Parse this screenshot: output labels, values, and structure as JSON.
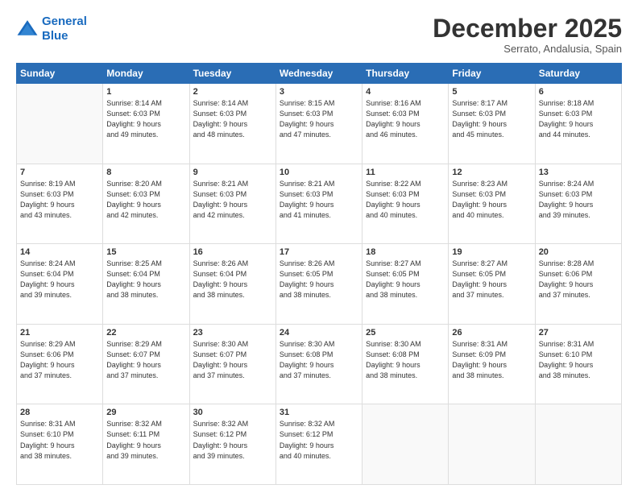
{
  "header": {
    "logo_line1": "General",
    "logo_line2": "Blue",
    "month": "December 2025",
    "location": "Serrato, Andalusia, Spain"
  },
  "weekdays": [
    "Sunday",
    "Monday",
    "Tuesday",
    "Wednesday",
    "Thursday",
    "Friday",
    "Saturday"
  ],
  "weeks": [
    [
      {
        "day": "",
        "info": ""
      },
      {
        "day": "1",
        "info": "Sunrise: 8:14 AM\nSunset: 6:03 PM\nDaylight: 9 hours\nand 49 minutes."
      },
      {
        "day": "2",
        "info": "Sunrise: 8:14 AM\nSunset: 6:03 PM\nDaylight: 9 hours\nand 48 minutes."
      },
      {
        "day": "3",
        "info": "Sunrise: 8:15 AM\nSunset: 6:03 PM\nDaylight: 9 hours\nand 47 minutes."
      },
      {
        "day": "4",
        "info": "Sunrise: 8:16 AM\nSunset: 6:03 PM\nDaylight: 9 hours\nand 46 minutes."
      },
      {
        "day": "5",
        "info": "Sunrise: 8:17 AM\nSunset: 6:03 PM\nDaylight: 9 hours\nand 45 minutes."
      },
      {
        "day": "6",
        "info": "Sunrise: 8:18 AM\nSunset: 6:03 PM\nDaylight: 9 hours\nand 44 minutes."
      }
    ],
    [
      {
        "day": "7",
        "info": "Sunrise: 8:19 AM\nSunset: 6:03 PM\nDaylight: 9 hours\nand 43 minutes."
      },
      {
        "day": "8",
        "info": "Sunrise: 8:20 AM\nSunset: 6:03 PM\nDaylight: 9 hours\nand 42 minutes."
      },
      {
        "day": "9",
        "info": "Sunrise: 8:21 AM\nSunset: 6:03 PM\nDaylight: 9 hours\nand 42 minutes."
      },
      {
        "day": "10",
        "info": "Sunrise: 8:21 AM\nSunset: 6:03 PM\nDaylight: 9 hours\nand 41 minutes."
      },
      {
        "day": "11",
        "info": "Sunrise: 8:22 AM\nSunset: 6:03 PM\nDaylight: 9 hours\nand 40 minutes."
      },
      {
        "day": "12",
        "info": "Sunrise: 8:23 AM\nSunset: 6:03 PM\nDaylight: 9 hours\nand 40 minutes."
      },
      {
        "day": "13",
        "info": "Sunrise: 8:24 AM\nSunset: 6:03 PM\nDaylight: 9 hours\nand 39 minutes."
      }
    ],
    [
      {
        "day": "14",
        "info": "Sunrise: 8:24 AM\nSunset: 6:04 PM\nDaylight: 9 hours\nand 39 minutes."
      },
      {
        "day": "15",
        "info": "Sunrise: 8:25 AM\nSunset: 6:04 PM\nDaylight: 9 hours\nand 38 minutes."
      },
      {
        "day": "16",
        "info": "Sunrise: 8:26 AM\nSunset: 6:04 PM\nDaylight: 9 hours\nand 38 minutes."
      },
      {
        "day": "17",
        "info": "Sunrise: 8:26 AM\nSunset: 6:05 PM\nDaylight: 9 hours\nand 38 minutes."
      },
      {
        "day": "18",
        "info": "Sunrise: 8:27 AM\nSunset: 6:05 PM\nDaylight: 9 hours\nand 38 minutes."
      },
      {
        "day": "19",
        "info": "Sunrise: 8:27 AM\nSunset: 6:05 PM\nDaylight: 9 hours\nand 37 minutes."
      },
      {
        "day": "20",
        "info": "Sunrise: 8:28 AM\nSunset: 6:06 PM\nDaylight: 9 hours\nand 37 minutes."
      }
    ],
    [
      {
        "day": "21",
        "info": "Sunrise: 8:29 AM\nSunset: 6:06 PM\nDaylight: 9 hours\nand 37 minutes."
      },
      {
        "day": "22",
        "info": "Sunrise: 8:29 AM\nSunset: 6:07 PM\nDaylight: 9 hours\nand 37 minutes."
      },
      {
        "day": "23",
        "info": "Sunrise: 8:30 AM\nSunset: 6:07 PM\nDaylight: 9 hours\nand 37 minutes."
      },
      {
        "day": "24",
        "info": "Sunrise: 8:30 AM\nSunset: 6:08 PM\nDaylight: 9 hours\nand 37 minutes."
      },
      {
        "day": "25",
        "info": "Sunrise: 8:30 AM\nSunset: 6:08 PM\nDaylight: 9 hours\nand 38 minutes."
      },
      {
        "day": "26",
        "info": "Sunrise: 8:31 AM\nSunset: 6:09 PM\nDaylight: 9 hours\nand 38 minutes."
      },
      {
        "day": "27",
        "info": "Sunrise: 8:31 AM\nSunset: 6:10 PM\nDaylight: 9 hours\nand 38 minutes."
      }
    ],
    [
      {
        "day": "28",
        "info": "Sunrise: 8:31 AM\nSunset: 6:10 PM\nDaylight: 9 hours\nand 38 minutes."
      },
      {
        "day": "29",
        "info": "Sunrise: 8:32 AM\nSunset: 6:11 PM\nDaylight: 9 hours\nand 39 minutes."
      },
      {
        "day": "30",
        "info": "Sunrise: 8:32 AM\nSunset: 6:12 PM\nDaylight: 9 hours\nand 39 minutes."
      },
      {
        "day": "31",
        "info": "Sunrise: 8:32 AM\nSunset: 6:12 PM\nDaylight: 9 hours\nand 40 minutes."
      },
      {
        "day": "",
        "info": ""
      },
      {
        "day": "",
        "info": ""
      },
      {
        "day": "",
        "info": ""
      }
    ]
  ]
}
